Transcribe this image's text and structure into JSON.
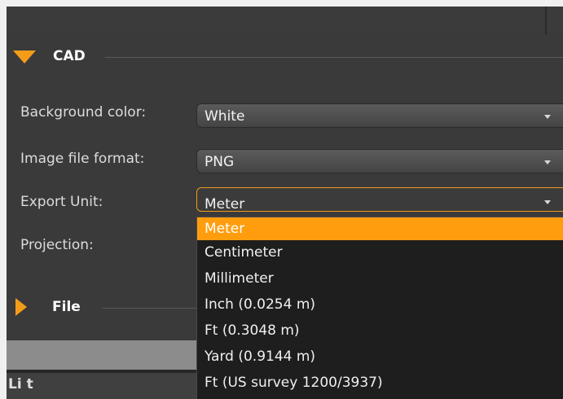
{
  "sections": {
    "cad": {
      "title": "CAD"
    },
    "file": {
      "title": "File"
    }
  },
  "fields": {
    "background_color": {
      "label": "Background color:",
      "value": "White"
    },
    "image_file_format": {
      "label": "Image file format:",
      "value": "PNG"
    },
    "export_unit": {
      "label": "Export Unit:",
      "value": "Meter"
    },
    "projection": {
      "label": "Projection:"
    }
  },
  "export_unit_options": [
    "Meter",
    "Centimeter",
    "Millimeter",
    "Inch (0.0254 m)",
    "Ft (0.3048 m)",
    "Yard (0.9144 m)",
    "Ft (US survey 1200/3937)"
  ],
  "bottom": {
    "partial_text": "Li t"
  },
  "colors": {
    "accent": "#f39c1a",
    "selected_option": "#ff9d0e",
    "panel_bg": "#3a3a3a"
  }
}
